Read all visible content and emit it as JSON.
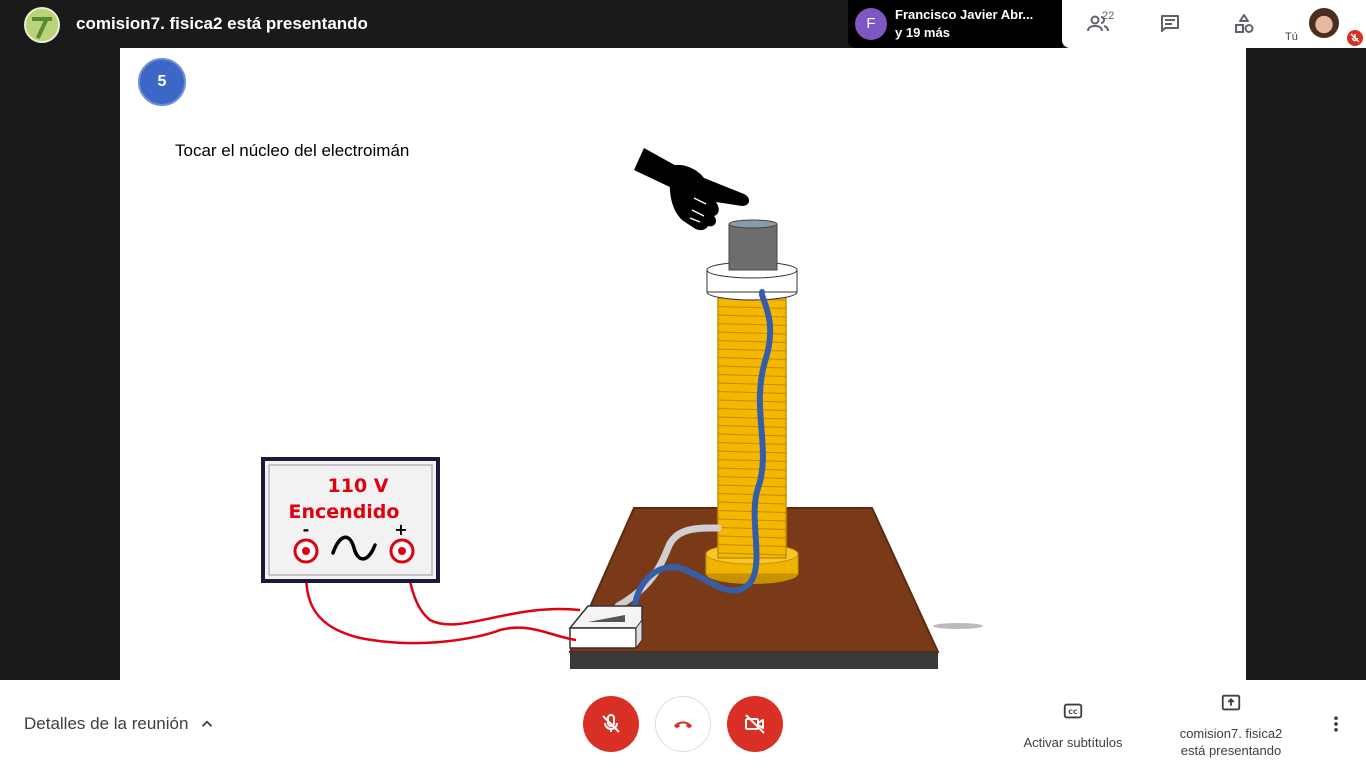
{
  "header": {
    "presenting_title": "comision7. fisica2 está presentando",
    "participant": {
      "initial": "F",
      "name": "Francisco Javier Abr...",
      "others": "y 19 más"
    },
    "people_count": "22",
    "self_label": "Tú"
  },
  "slide": {
    "number": "5",
    "caption": "Tocar el núcleo del electroimán",
    "source_voltage": "110 V",
    "source_status": "Encendido",
    "minus_label": "-",
    "plus_label": "+"
  },
  "bottom": {
    "meeting_details": "Detalles de la reunión",
    "captions_label": "Activar subtítulos",
    "presenting_line1": "comision7. fisica2",
    "presenting_line2": "está presentando"
  },
  "icons": {
    "people": "people-icon",
    "chat": "chat-icon",
    "activities": "activities-icon",
    "mic_off": "mic-off-icon",
    "hang_up": "hang-up-icon",
    "camera_off": "camera-off-icon",
    "captions": "captions-icon",
    "present": "present-icon",
    "more": "more-vertical-icon",
    "chevron": "chevron-up-icon"
  },
  "colors": {
    "accent_red": "#d93025",
    "slide_badge": "#3d67c6",
    "coil": "#f5b800",
    "wire": "#355ea8",
    "base": "#7a3a18"
  }
}
